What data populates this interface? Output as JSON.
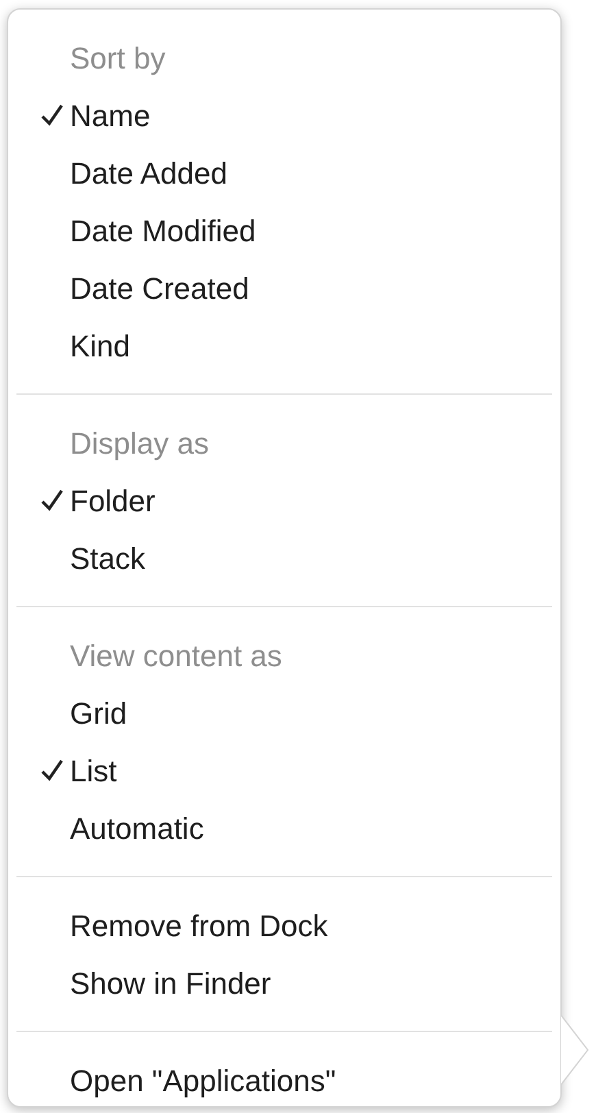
{
  "menu": {
    "sections": [
      {
        "header": "Sort by",
        "items": [
          {
            "label": "Name",
            "checked": true
          },
          {
            "label": "Date Added",
            "checked": false
          },
          {
            "label": "Date Modified",
            "checked": false
          },
          {
            "label": "Date Created",
            "checked": false
          },
          {
            "label": "Kind",
            "checked": false
          }
        ]
      },
      {
        "header": "Display as",
        "items": [
          {
            "label": "Folder",
            "checked": true
          },
          {
            "label": "Stack",
            "checked": false
          }
        ]
      },
      {
        "header": "View content as",
        "items": [
          {
            "label": "Grid",
            "checked": false
          },
          {
            "label": "List",
            "checked": true
          },
          {
            "label": "Automatic",
            "checked": false
          }
        ]
      },
      {
        "items": [
          {
            "label": "Remove from Dock",
            "checked": false
          },
          {
            "label": "Show in Finder",
            "checked": false
          }
        ]
      },
      {
        "items": [
          {
            "label": "Open \"Applications\"",
            "checked": false
          }
        ]
      }
    ]
  }
}
